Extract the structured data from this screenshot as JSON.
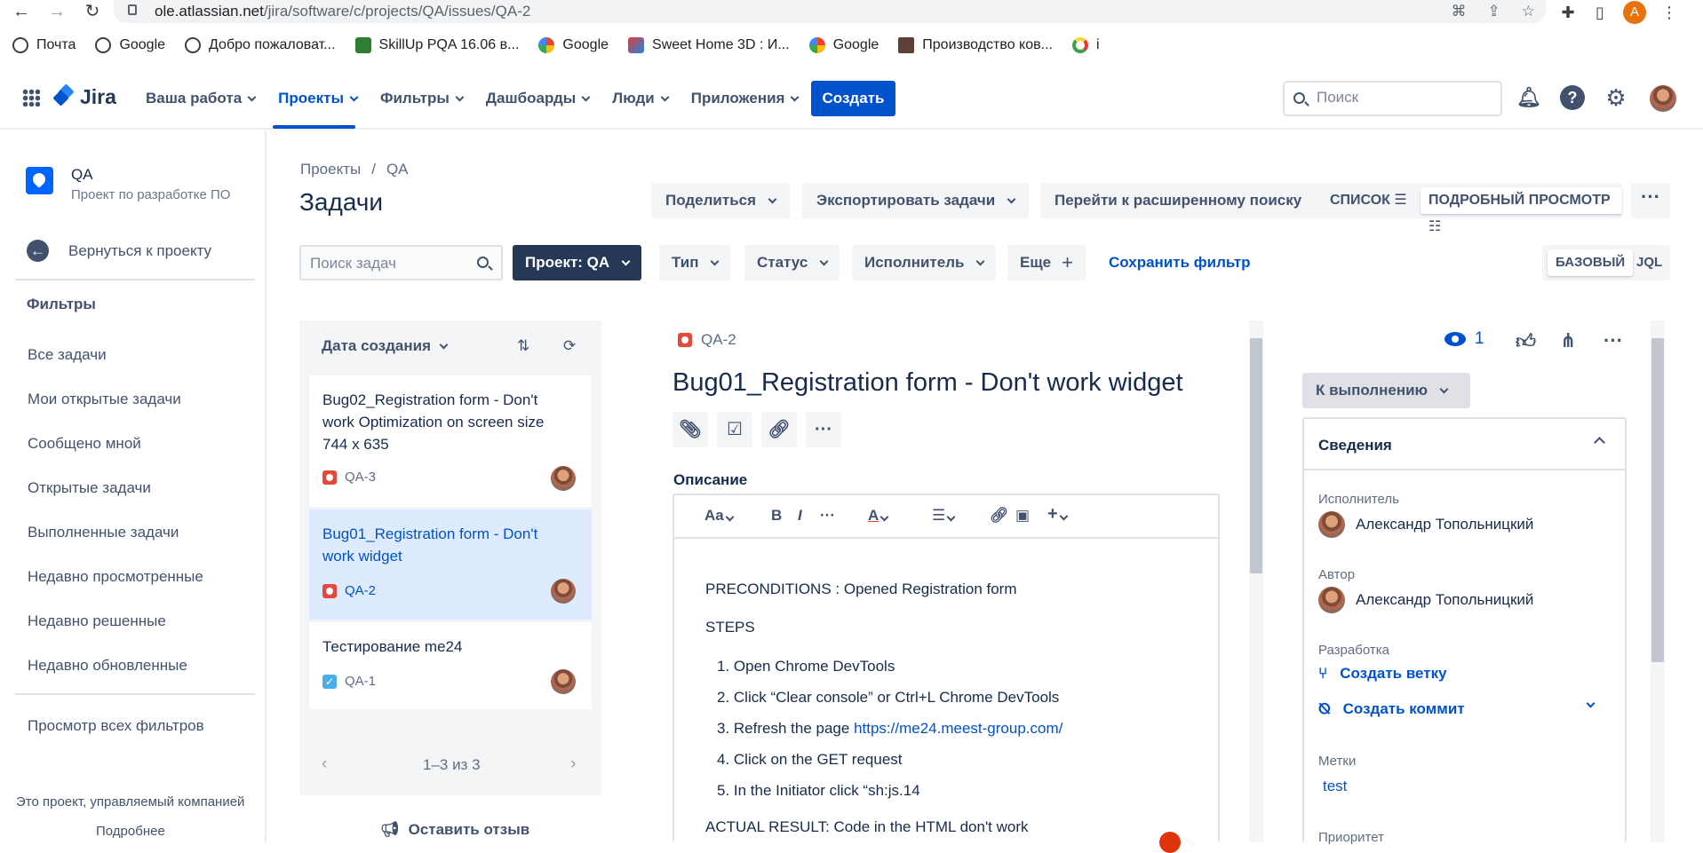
{
  "browser": {
    "url_host": "ole.atlassian.net",
    "url_path": "/jira/software/c/projects/QA/issues/QA-2",
    "profile_initial": "A"
  },
  "bookmarks": [
    {
      "label": "Почта",
      "icon": "globe-icon"
    },
    {
      "label": "Google",
      "icon": "globe-icon"
    },
    {
      "label": "Добро пожаловат...",
      "icon": "globe-icon"
    },
    {
      "label": "SkillUp PQA 16.06 в...",
      "icon": "classroom-icon"
    },
    {
      "label": "Google",
      "icon": "google-icon"
    },
    {
      "label": "Sweet Home 3D : И...",
      "icon": "cube-icon"
    },
    {
      "label": "Google",
      "icon": "google-icon"
    },
    {
      "label": "Производство ков...",
      "icon": "book-icon"
    },
    {
      "label": "i",
      "icon": "ring-icon"
    }
  ],
  "header": {
    "product": "Jira",
    "nav": [
      "Ваша работа",
      "Проекты",
      "Фильтры",
      "Дашбоарды",
      "Люди",
      "Приложения"
    ],
    "create": "Создать",
    "search_placeholder": "Поиск"
  },
  "sidebar": {
    "project_name": "QA",
    "project_sub": "Проект по разработке ПО",
    "back": "Вернуться к проекту",
    "filters_heading": "Фильтры",
    "items": [
      "Все задачи",
      "Мои открытые задачи",
      "Сообщено мной",
      "Открытые задачи",
      "Выполненные задачи",
      "Недавно просмотренные",
      "Недавно решенные",
      "Недавно обновленные"
    ],
    "all_filters": "Просмотр всех фильтров",
    "footer_text": "Это проект, управляемый компанией",
    "footer_link": "Подробнее"
  },
  "main": {
    "breadcrumb": [
      "Проекты",
      "/",
      "QA"
    ],
    "title": "Задачи",
    "toolbar": {
      "share": "Поделиться",
      "export": "Экспортировать задачи",
      "advanced": "Перейти к расширенному поиску",
      "list_view": "СПИСОК",
      "detail_view": "ПОДРОБНЫЙ ПРОСМОТР"
    },
    "filters": {
      "search_placeholder": "Поиск задач",
      "project": "Проект: QA",
      "type": "Тип",
      "status": "Статус",
      "assignee": "Исполнитель",
      "more": "Еще",
      "save": "Сохранить фильтр",
      "basic": "БАЗОВЫЙ",
      "jql": "JQL"
    }
  },
  "issue_list": {
    "sort_label": "Дата создания",
    "issues": [
      {
        "title": "Bug02_Registration form - Don't work Optimization on screen size 744 x 635",
        "key": "QA-3",
        "type": "bug"
      },
      {
        "title": "Bug01_Registration form - Don't work widget",
        "key": "QA-2",
        "type": "bug"
      },
      {
        "title": "Тестирование me24",
        "key": "QA-1",
        "type": "task"
      }
    ],
    "pager": "1–3 из 3",
    "feedback": "Оставить отзыв"
  },
  "issue_detail": {
    "key": "QA-2",
    "title": "Bug01_Registration form - Don't work widget",
    "description_label": "Описание",
    "toolbar": {
      "text_style": "Aa",
      "bold": "B",
      "italic": "I",
      "more": "···",
      "color": "A",
      "insert": "+"
    },
    "preconditions": "PRECONDITIONS : Opened Registration form",
    "steps_label": "STEPS",
    "steps": [
      "Open Chrome DevTools",
      "Click “Clear console” or Ctrl+L Chrome DevTools",
      "Refresh the page ",
      "Click on the GET request",
      "In the Initiator click “sh:js.14"
    ],
    "step3_link": "https://me24.meest-group.com/",
    "actual_result": "ACTUAL RESULT: Code in the HTML don't work"
  },
  "right_panel": {
    "watchers": "1",
    "status": "К выполнению",
    "details_title": "Сведения",
    "assignee_label": "Исполнитель",
    "assignee": "Александр Топольницкий",
    "reporter_label": "Автор",
    "reporter": "Александр Топольницкий",
    "development_label": "Разработка",
    "create_branch": "Создать ветку",
    "create_commit": "Создать коммит",
    "labels_label": "Метки",
    "label_value": "test",
    "priority_label": "Приоритет"
  }
}
